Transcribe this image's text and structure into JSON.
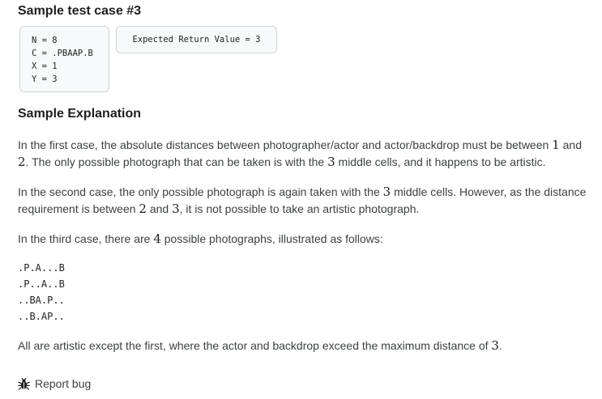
{
  "sample": {
    "title": "Sample test case #3",
    "input_lines": [
      "N = 8",
      "C = .PBAAP.B",
      "X = 1",
      "Y = 3"
    ],
    "expected": "Expected Return Value = 3"
  },
  "explanation": {
    "title": "Sample Explanation",
    "p1": {
      "a": "In the first case, the absolute distances between photographer/actor and actor/backdrop must be between ",
      "n1": "1",
      "b": " and ",
      "n2": "2",
      "c": ". The only possible photograph that can be taken is with the ",
      "n3": "3",
      "d": " middle cells, and it happens to be artistic."
    },
    "p2": {
      "a": "In the second case, the only possible photograph is again taken with the ",
      "n1": "3",
      "b": " middle cells. However, as the distance requirement is between ",
      "n2": "2",
      "c": " and ",
      "n3": "3",
      "d": ", it is not possible to take an artistic photograph."
    },
    "p3": {
      "a": "In the third case, there are ",
      "n1": "4",
      "b": " possible photographs, illustrated as follows:"
    },
    "code_lines": [
      ".P.A...B",
      ".P..A..B",
      "..BA.P..",
      "..B.AP.."
    ],
    "p4": {
      "a": "All are artistic except the first, where the actor and backdrop exceed the maximum distance of ",
      "n1": "3",
      "b": "."
    }
  },
  "report": {
    "label": "Report bug",
    "icon": "bug-icon"
  },
  "colors": {
    "text": "#3c4043",
    "heading": "#1f1f1f",
    "box_border": "#cfd3d7",
    "box_bg": "#f8f9fa"
  }
}
